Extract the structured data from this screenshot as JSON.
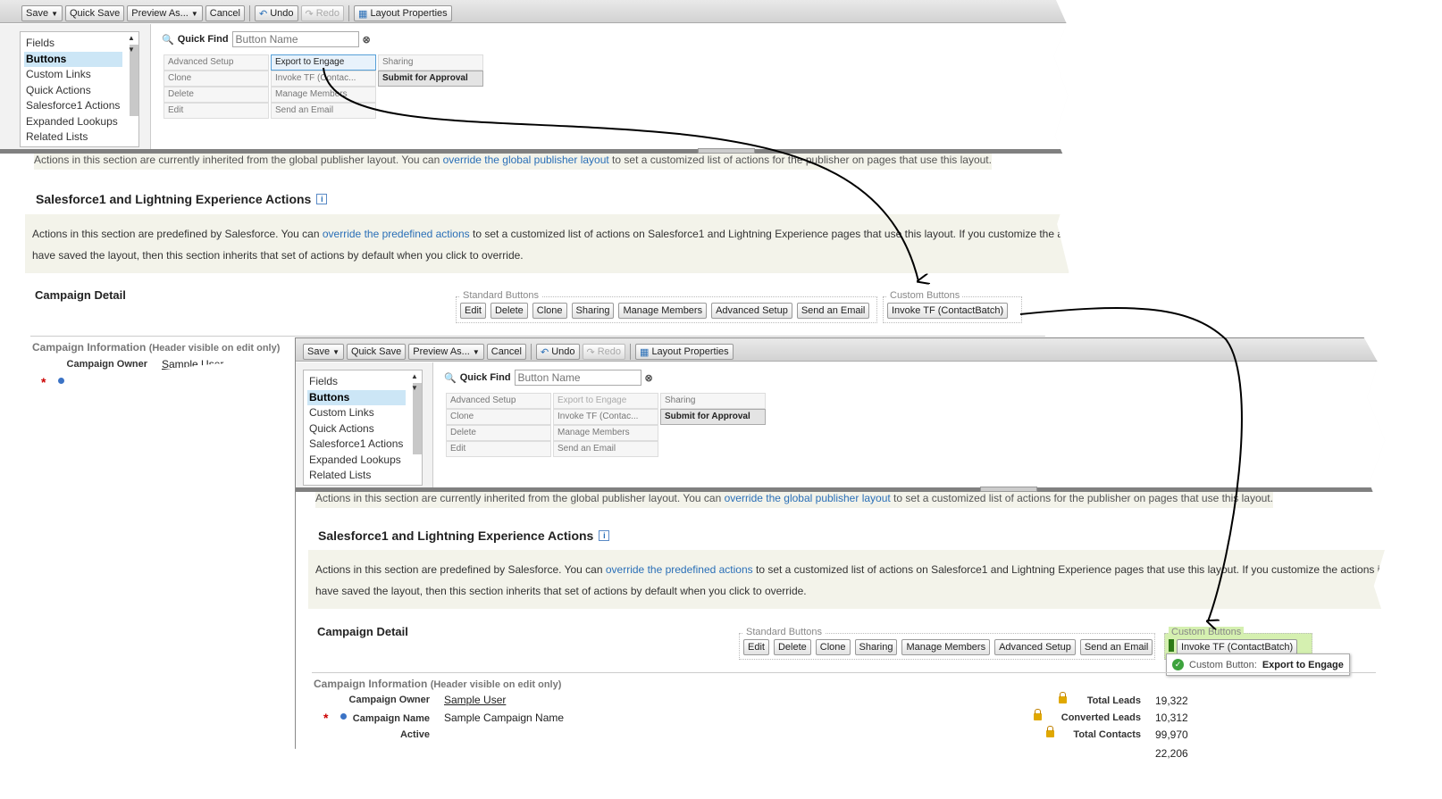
{
  "toolbar": {
    "save": "Save",
    "quick_save": "Quick Save",
    "preview_as": "Preview As...",
    "cancel": "Cancel",
    "undo": "Undo",
    "redo": "Redo",
    "layout_properties": "Layout Properties"
  },
  "palette": {
    "categories": [
      "Fields",
      "Buttons",
      "Custom Links",
      "Quick Actions",
      "Salesforce1 Actions",
      "Expanded Lookups",
      "Related Lists"
    ],
    "quick_find_label": "Quick Find",
    "quick_find_placeholder": "Button Name",
    "top_cells": [
      "Advanced Setup",
      "Export to Engage",
      "Sharing",
      "Clone",
      "Invoke TF (Contac...",
      "Submit for Approval",
      "Delete",
      "Manage Members",
      "",
      "Edit",
      "Send an Email",
      ""
    ],
    "bottom_cells": [
      "Advanced Setup",
      "Export to Engage",
      "Sharing",
      "Clone",
      "Invoke TF (Contac...",
      "Submit for Approval",
      "Delete",
      "Manage Members",
      "",
      "Edit",
      "Send an Email",
      ""
    ]
  },
  "inherit_text": {
    "before": "Actions in this section are currently inherited from the global publisher layout. You can ",
    "link": "override the global publisher layout",
    "after": " to set a customized list of actions for the publisher on pages that use this layout."
  },
  "sf1_section": {
    "title": "Salesforce1 and Lightning Experience Actions",
    "info": "i",
    "line1_before": "Actions in this section are predefined by Salesforce. You can ",
    "line1_link": "override the predefined actions",
    "line1_after_top": " to set a customized list of actions on Salesforce1 and Lightning Experience pages that use this layout. If you customize the actions in the",
    "line1_after_bottom": " to set a customized list of actions on Salesforce1 and Lightning Experience pages that use this layout. If you customize the actions in the",
    "line2": "have saved the layout, then this section inherits that set of actions by default when you click to override."
  },
  "detail": {
    "title": "Campaign Detail",
    "standard_legend": "Standard Buttons",
    "custom_legend": "Custom Buttons",
    "standard_buttons": [
      "Edit",
      "Delete",
      "Clone",
      "Sharing",
      "Manage Members",
      "Advanced Setup",
      "Send an Email"
    ],
    "custom_button": "Invoke TF (ContactBatch)",
    "tooltip_label": "Custom Button:",
    "tooltip_value": "Export to Engage"
  },
  "campaign_info": {
    "header": "Campaign Information",
    "header_sub": "(Header visible on edit only)",
    "owner_label": "Campaign Owner",
    "owner_value": "Sample User",
    "name_label": "Campaign Name",
    "name_value": "Sample Campaign Name",
    "active_label": "Active",
    "stats": [
      {
        "label": "Total Leads",
        "value": "19,322"
      },
      {
        "label": "Converted Leads",
        "value": "10,312"
      },
      {
        "label": "Total Contacts",
        "value": "99,970"
      }
    ],
    "extra_value": "22,206"
  }
}
